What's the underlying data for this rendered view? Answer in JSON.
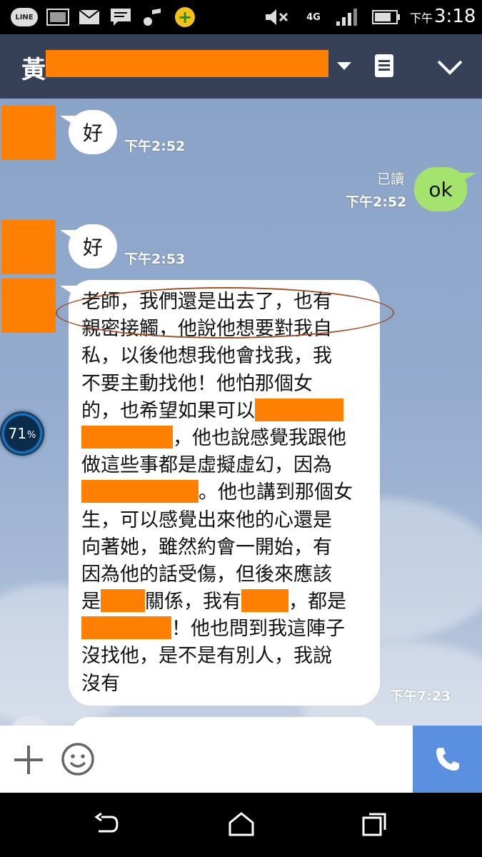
{
  "status_bar": {
    "line_badge": "LINE",
    "network": "4G",
    "time_ampm": "下午",
    "time_clock": "3:18",
    "icons": [
      "line-app-icon",
      "image-icon",
      "mail-icon",
      "message-icon",
      "music-icon",
      "plus-app-icon",
      "mute-icon",
      "signal-icon",
      "battery-icon"
    ]
  },
  "header": {
    "contact_name_visible": "黃",
    "icons": [
      "dropdown-arrow-icon",
      "list-icon",
      "chevron-down-icon"
    ]
  },
  "messages": [
    {
      "side": "in",
      "text": "好",
      "time": "下午2:52"
    },
    {
      "side": "out",
      "text": "ok",
      "read": "已讀",
      "time": "下午2:52"
    },
    {
      "side": "in",
      "text": "好",
      "time": "下午2:53"
    },
    {
      "side": "in",
      "time": "下午7:23",
      "lines": [
        "老師，我們還是出去了，也有",
        "親密接觸，他說他想要對我自",
        "私，以後他想我他會找我，我",
        "不要主動找他！他怕那個女",
        "的，也希望如果可以",
        "，他也說感覺我跟他",
        "做這些事都是虛擬虛幻，因為",
        "。他也講到那個女",
        "生，可以感覺出來他的心還是",
        "向著她，雖然約會一開始，有",
        "因為他的話受傷，但後來應該",
        "是",
        "關係，我有",
        "，都是",
        "！他也問到我這陣子",
        "沒找他，是不是有別人，我說",
        "沒有"
      ]
    }
  ],
  "battery_widget": {
    "value": "71",
    "unit": "%"
  },
  "colors": {
    "header_bg": "#364157",
    "outgoing_bubble": "#a5e36f",
    "incoming_bubble": "#ffffff",
    "redaction": "#ff8000",
    "call_button": "#5b8fe0",
    "annotation_ellipse": "#a0522d"
  },
  "input_bar": {
    "icons": [
      "plus-icon",
      "emoji-icon",
      "phone-icon"
    ]
  },
  "nav_bar": {
    "icons": [
      "back-icon",
      "home-icon",
      "recent-apps-icon"
    ]
  }
}
